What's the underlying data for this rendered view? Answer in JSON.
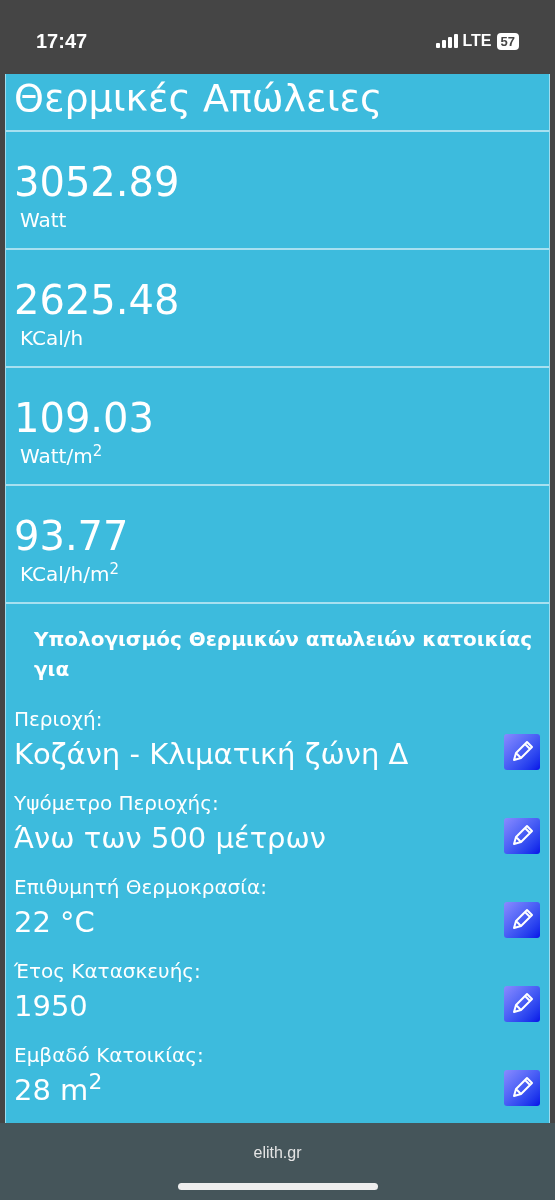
{
  "status_bar": {
    "time": "17:47",
    "network": "LTE",
    "battery": "57"
  },
  "title": "Θερμικές Απώλειες",
  "results": [
    {
      "value": "3052.89",
      "unit": "Watt"
    },
    {
      "value": "2625.48",
      "unit": "KCal/h"
    },
    {
      "value": "109.03",
      "unit": "Watt/m$^{2}$"
    },
    {
      "value": "93.77",
      "unit": "KCal/h/m$^{2}$"
    }
  ],
  "section_heading": "Υπολογισμός Θερμικών απωλειών κατοικίας για",
  "fields": [
    {
      "label": "Περιοχή:",
      "value": "Κοζάνη - Κλιματική ζώνη Δ"
    },
    {
      "label": "Υψόμετρο Περιοχής:",
      "value": "Άνω των 500 μέτρων"
    },
    {
      "label": "Επιθυμητή Θερμοκρασία:",
      "value": "22 °C"
    },
    {
      "label": "Έτος Κατασκευής:",
      "value": "1950"
    },
    {
      "label": "Εμβαδό Κατοικίας:",
      "value": "28 m$^{2}$"
    }
  ],
  "browser_bar": {
    "url": "elith.gr"
  }
}
